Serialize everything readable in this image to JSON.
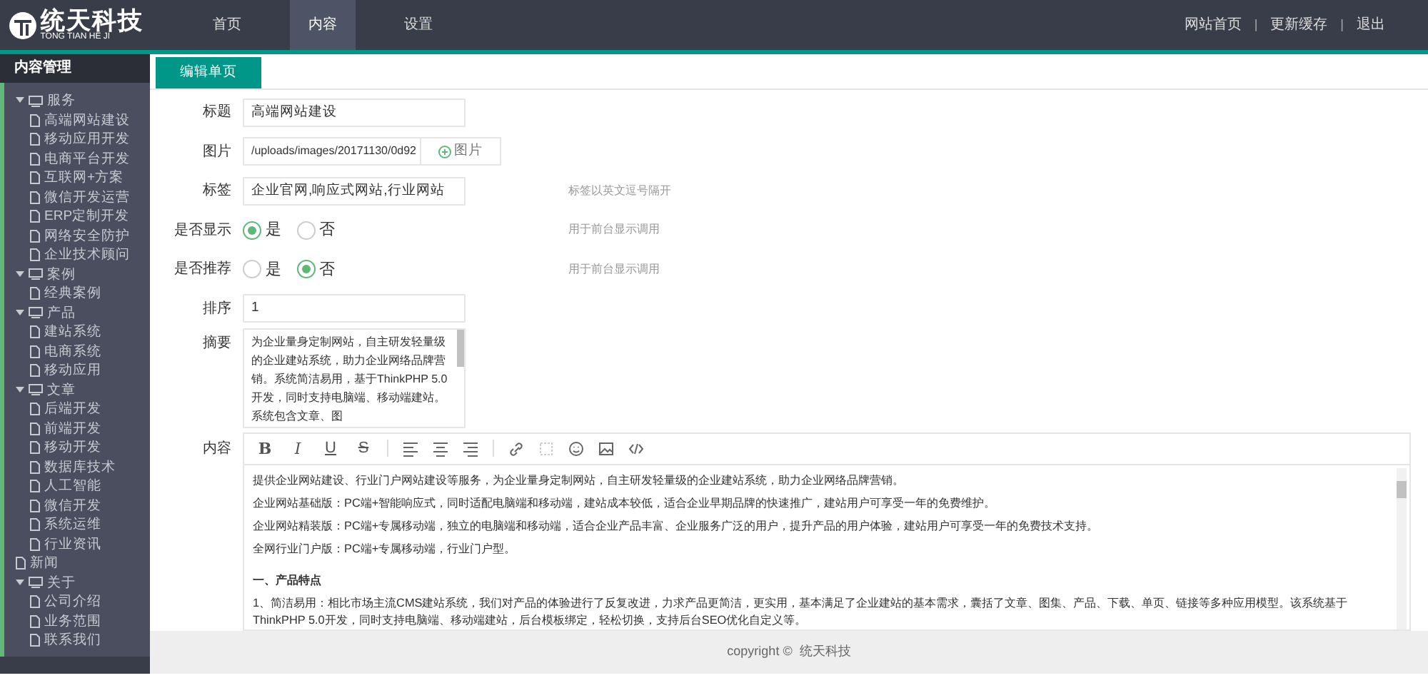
{
  "header": {
    "logo_title": "统天科技",
    "logo_subtitle": "TONG TIAN HE JI",
    "nav": [
      {
        "label": "首页",
        "selected": false
      },
      {
        "label": "内容",
        "selected": true
      },
      {
        "label": "设置",
        "selected": false
      }
    ],
    "links": [
      "网站首页",
      "更新缓存",
      "退出"
    ],
    "separator": "|"
  },
  "sidebar": {
    "title": "内容管理",
    "items": [
      {
        "label": "服务",
        "expanded": true,
        "children": [
          {
            "label": "高端网站建设"
          },
          {
            "label": "移动应用开发"
          },
          {
            "label": "电商平台开发"
          },
          {
            "label": "互联网+方案"
          },
          {
            "label": "微信开发运营"
          },
          {
            "label": "ERP定制开发"
          },
          {
            "label": "网络安全防护"
          },
          {
            "label": "企业技术顾问"
          }
        ]
      },
      {
        "label": "案例",
        "expanded": true,
        "children": [
          {
            "label": "经典案例"
          }
        ]
      },
      {
        "label": "产品",
        "expanded": true,
        "children": [
          {
            "label": "建站系统"
          },
          {
            "label": "电商系统"
          },
          {
            "label": "移动应用"
          }
        ]
      },
      {
        "label": "文章",
        "expanded": true,
        "children": [
          {
            "label": "后端开发"
          },
          {
            "label": "前端开发"
          },
          {
            "label": "移动开发"
          },
          {
            "label": "数据库技术"
          },
          {
            "label": "人工智能"
          },
          {
            "label": "微信开发"
          },
          {
            "label": "系统运维"
          },
          {
            "label": "行业资讯"
          }
        ]
      },
      {
        "label": "新闻"
      },
      {
        "label": "关于",
        "expanded": true,
        "children": [
          {
            "label": "公司介绍"
          },
          {
            "label": "业务范围"
          },
          {
            "label": "联系我们"
          }
        ]
      }
    ]
  },
  "tabs": [
    {
      "label": "编辑单页",
      "selected": true
    }
  ],
  "form": [
    {
      "kind": "text",
      "label": "标题",
      "value": "高端网站建设"
    },
    {
      "kind": "image",
      "label": "图片",
      "value": "/uploads/images/20171130/0d92",
      "button": "图片"
    },
    {
      "kind": "text",
      "label": "标签",
      "value": "企业官网,响应式网站,行业网站",
      "hint": "标签以英文逗号隔开"
    },
    {
      "kind": "radio",
      "label": "是否显示",
      "options": [
        {
          "label": "是",
          "selected": true
        },
        {
          "label": "否",
          "selected": false
        }
      ],
      "hint": "用于前台显示调用"
    },
    {
      "kind": "radio",
      "label": "是否推荐",
      "options": [
        {
          "label": "是",
          "selected": false
        },
        {
          "label": "否",
          "selected": true
        }
      ],
      "hint": "用于前台显示调用"
    },
    {
      "kind": "text",
      "label": "排序",
      "value": "1"
    },
    {
      "kind": "textarea",
      "label": "摘要",
      "value": "为企业量身定制网站，自主研发轻量级的企业建站系统，助力企业网络品牌营销。系统简洁易用，基于ThinkPHP 5.0开发，同时支持电脑端、移动端建站。系统包含文章、图"
    }
  ],
  "editor": {
    "label": "内容",
    "toolbar": [
      {
        "kind": "bold",
        "label": "B"
      },
      {
        "kind": "italic",
        "label": "I"
      },
      {
        "kind": "underline",
        "label": "U"
      },
      {
        "kind": "strike",
        "label": "S"
      },
      {
        "kind": "sep"
      },
      {
        "kind": "align-left"
      },
      {
        "kind": "align-center"
      },
      {
        "kind": "align-right"
      },
      {
        "kind": "sep"
      },
      {
        "kind": "link"
      },
      {
        "kind": "unlink",
        "disabled": true
      },
      {
        "kind": "emoji"
      },
      {
        "kind": "image"
      },
      {
        "kind": "code"
      }
    ],
    "content": [
      {
        "kind": "p",
        "text": "提供企业网站建设、行业门户网站建设等服务，为企业量身定制网站，自主研发轻量级的企业建站系统，助力企业网络品牌营销。"
      },
      {
        "kind": "p",
        "text": "企业网站基础版：PC端+智能响应式，同时适配电脑端和移动端，建站成本较低，适合企业早期品牌的快速推广，建站用户可享受一年的免费维护。"
      },
      {
        "kind": "p",
        "text": "企业网站精装版：PC端+专属移动端，独立的电脑端和移动端，适合企业产品丰富、企业服务广泛的用户，提升产品的用户体验，建站用户可享受一年的免费技术支持。"
      },
      {
        "kind": "p",
        "text": "全网行业门户版：PC端+专属移动端，行业门户型。"
      },
      {
        "kind": "heading",
        "text": "一、产品特点"
      },
      {
        "kind": "p",
        "text": "1、简洁易用：相比市场主流CMS建站系统，我们对产品的体验进行了反复改进，力求产品更简洁，更实用，基本满足了企业建站的基本需求，囊括了文章、图集、产品、下载、单页、链接等多种应用模型。该系统基于ThinkPHP 5.0开发，同时支持电脑端、移动端建站，后台模板绑定，轻松切换，支持后台SEO优化自定义等。"
      }
    ]
  },
  "footer": {
    "copyright": "copyright ©",
    "company": "统天科技"
  }
}
